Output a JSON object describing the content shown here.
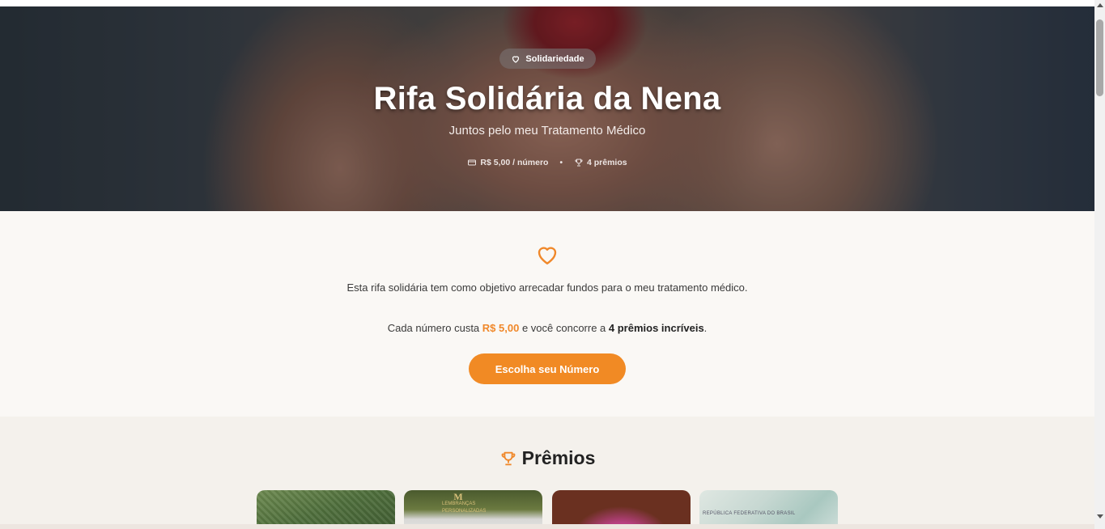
{
  "hero": {
    "badge": "Solidariedade",
    "badge_icon": "heart-icon",
    "title": "Rifa Solidária da Nena",
    "subtitle": "Juntos pelo meu Tratamento Médico",
    "price_label": "R$ 5,00 / número",
    "price_icon": "ticket-icon",
    "separator": "•",
    "prizes_label": "4 prêmios",
    "prizes_icon": "trophy-icon"
  },
  "intro": {
    "icon": "heart-icon",
    "text1": "Esta rifa solidária tem como objetivo arrecadar fundos para o meu tratamento médico.",
    "text2_prefix": "Cada número custa ",
    "text2_price": "R$ 5,00",
    "text2_middle": " e você concorre a ",
    "text2_prizes": "4 prêmios incríveis",
    "text2_suffix": ".",
    "cta": "Escolha seu Número"
  },
  "prizes": {
    "icon": "trophy-icon",
    "title": "Prêmios",
    "cards": [
      {
        "name": "prize-card-crochet"
      },
      {
        "name": "prize-card-personalized",
        "logo_letter": "M",
        "logo_text": "LEMBRANÇAS PERSONALIZADAS"
      },
      {
        "name": "prize-card-pink"
      },
      {
        "name": "prize-card-money",
        "text": "REPÚBLICA FEDERATIVA DO BRASIL"
      }
    ]
  },
  "colors": {
    "accent": "#f18a24",
    "intro_bg": "#faf8f5",
    "prizes_bg": "#f4f1ec"
  }
}
